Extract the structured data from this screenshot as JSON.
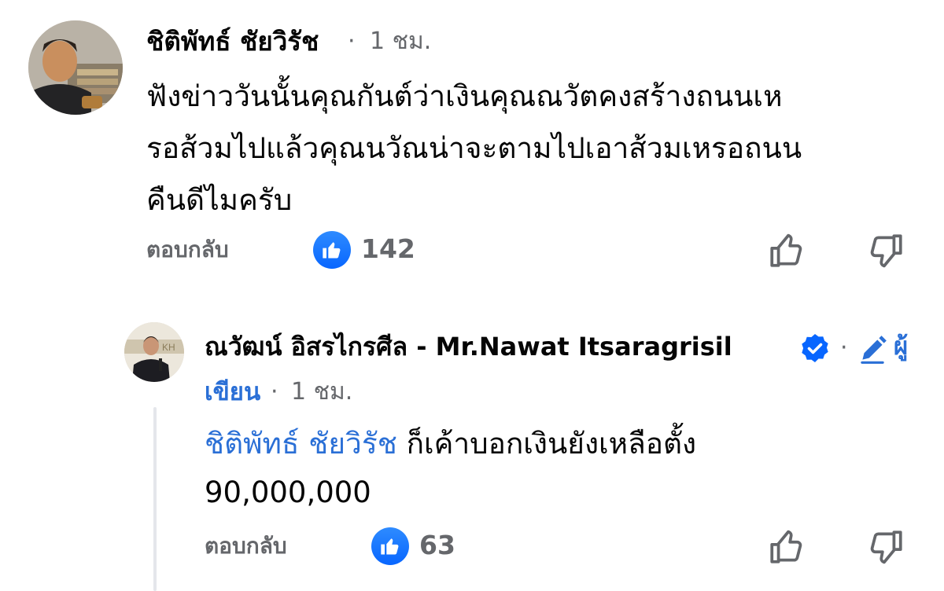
{
  "comments": [
    {
      "author": "ชิติพัทธ์ ชัยวิรัช",
      "separator": "·",
      "time": "1 ชม.",
      "lines": [
        "ฟังข่าววันนั้นคุณกันต์ว่าเงินคุณณวัตคงสร้างถนนเห",
        "รอส้วมไปแล้วคุณนวัณน่าจะตามไปเอาส้วมเหรอถนน",
        "คืนดีไมครับ"
      ],
      "reply_label": "ตอบกลับ",
      "like_count": "142"
    },
    {
      "author": "ณวัฒน์ อิสรไกรศีล - Mr.Nawat Itsaragrisil",
      "separator": "·",
      "role_prefix": "ผู้",
      "role_suffix": "เขียน",
      "time": "1 ชม.",
      "mention": "ชิติพัทธ์ ชัยวิรัช",
      "line1_rest": " ก็เค้าบอกเงินยังเหลือตั้ง",
      "line2": "90,000,000",
      "reply_label": "ตอบกลับ",
      "like_count": "63"
    }
  ],
  "icons": {
    "like_badge": "thumbs-up-icon",
    "upvote": "thumbs-up-outline-icon",
    "downvote": "thumbs-down-outline-icon",
    "verified": "verified-badge-icon",
    "author_badge": "pencil-icon"
  },
  "colors": {
    "text": "#050505",
    "meta": "#65676b",
    "accent": "#0866ff",
    "link": "#2a6fd6"
  }
}
